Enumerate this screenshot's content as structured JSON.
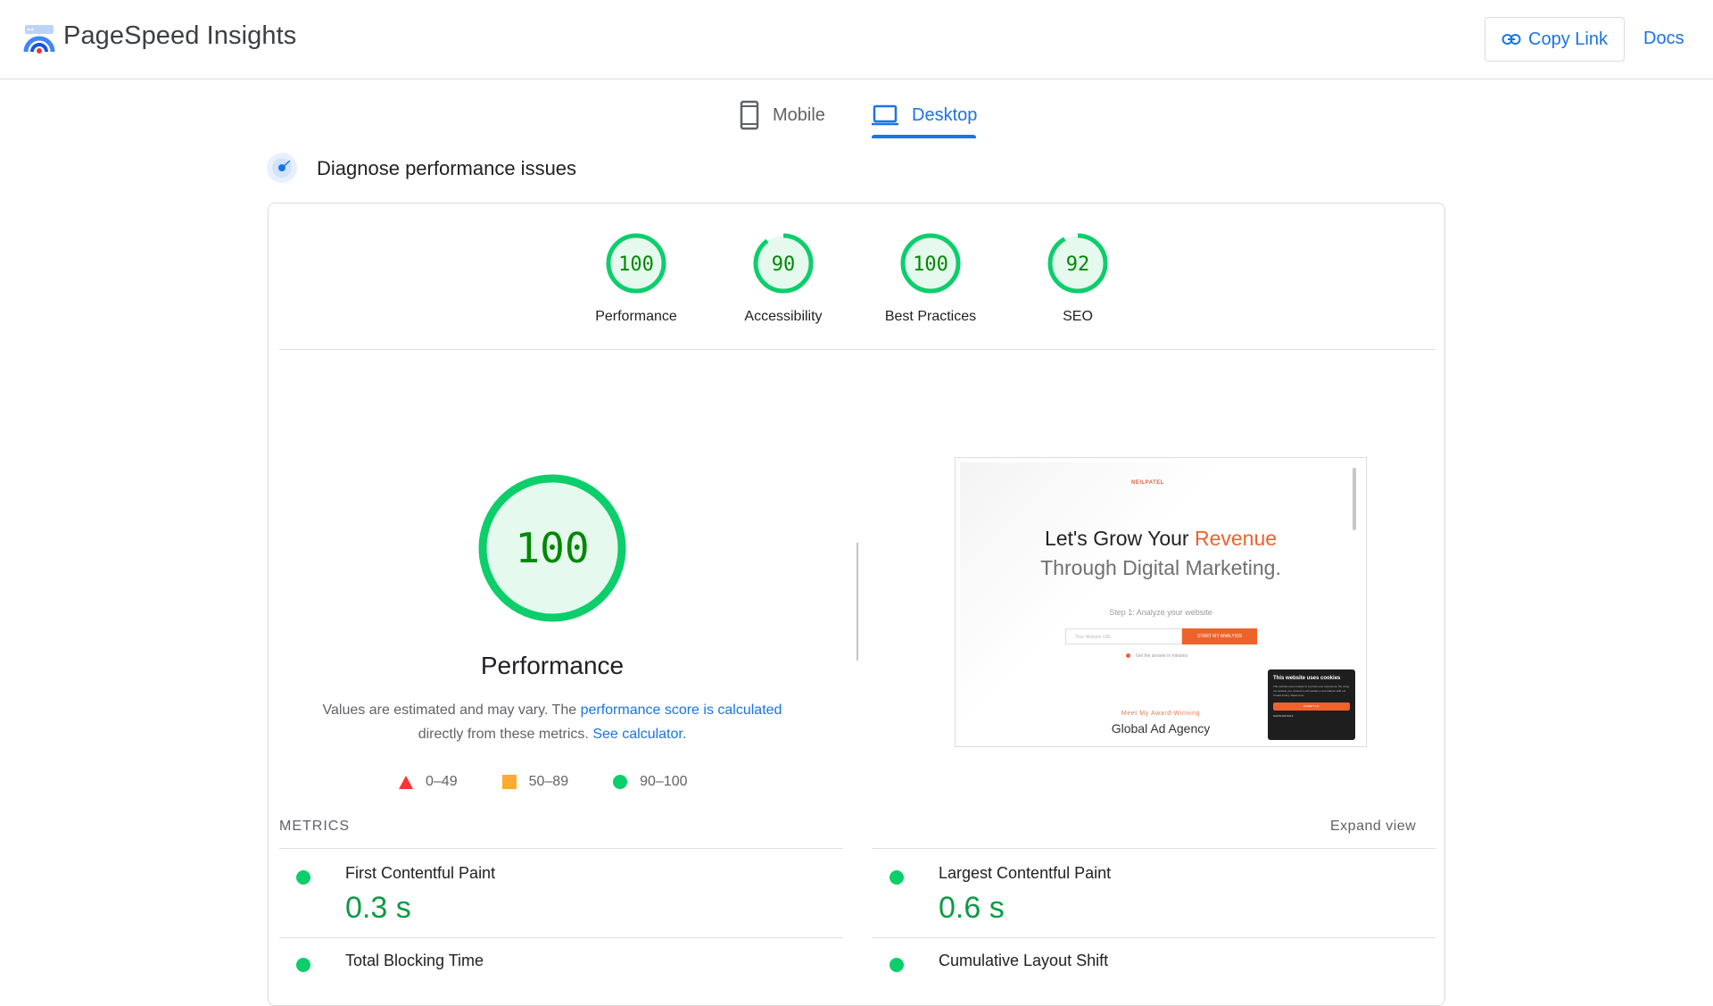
{
  "header": {
    "brand": "PageSpeed Insights",
    "copy_link": "Copy Link",
    "docs": "Docs"
  },
  "tabs": [
    {
      "label": "Mobile",
      "icon": "phone-icon",
      "active": false
    },
    {
      "label": "Desktop",
      "icon": "laptop-icon",
      "active": true
    }
  ],
  "diagnose": {
    "title": "Diagnose performance issues"
  },
  "gauges": [
    {
      "label": "Performance",
      "score": "100",
      "value": 100
    },
    {
      "label": "Accessibility",
      "score": "90",
      "value": 90
    },
    {
      "label": "Best Practices",
      "score": "100",
      "value": 100
    },
    {
      "label": "SEO",
      "score": "92",
      "value": 92
    }
  ],
  "performance": {
    "score": "100",
    "value": 100,
    "title": "Performance",
    "desc_pre": "Values are estimated and may vary. The ",
    "desc_link1": "performance score is calculated",
    "desc_mid": " directly from these metrics. ",
    "desc_link2": "See calculator.",
    "legend": [
      {
        "range": "0–49",
        "shape": "triangle",
        "color": "#ff3333"
      },
      {
        "range": "50–89",
        "shape": "square",
        "color": "#ffaa33"
      },
      {
        "range": "90–100",
        "shape": "circle",
        "color": "#0cce6b"
      }
    ]
  },
  "screenshot": {
    "brand": "NEILPATEL",
    "hero_line1_a": "Let's Grow Your ",
    "hero_line1_b": "Revenue",
    "hero_line2": "Through Digital Marketing.",
    "step": "Step 1: Analyze your website",
    "input_placeholder": "Your Website URL",
    "cta": "START MY ANALYSIS",
    "answer": "Get the answer in minutes",
    "award": "Meet My Award-Winning",
    "agency": "Global Ad Agency",
    "cookie_title": "This website uses cookies",
    "cookie_text": "This website uses cookies to improve user experience. By using our website you consent to all cookies in accordance with our Cookie Policy. Read more",
    "cookie_button": "ACCEPT ALL",
    "cookie_details": "SHOW DETAILS"
  },
  "metrics": {
    "label": "METRICS",
    "expand": "Expand view",
    "items": [
      {
        "title": "First Contentful Paint",
        "value": "0.3 s"
      },
      {
        "title": "Largest Contentful Paint",
        "value": "0.6 s"
      },
      {
        "title": "Total Blocking Time",
        "value": ""
      },
      {
        "title": "Cumulative Layout Shift",
        "value": ""
      }
    ]
  },
  "colors": {
    "pass": "#0cce6b",
    "pass_text": "#008800",
    "pass_bg": "#e6f9ee",
    "accent": "#1a73e8"
  }
}
